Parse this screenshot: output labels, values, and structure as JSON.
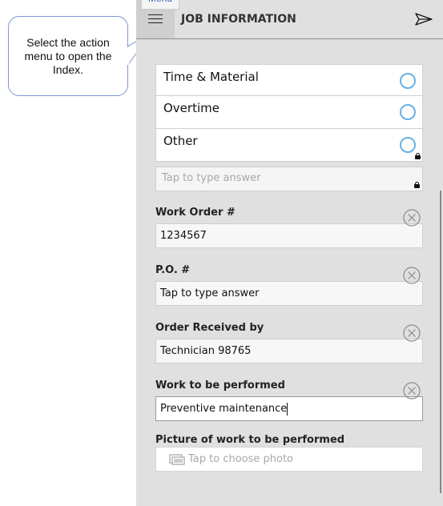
{
  "callout": {
    "text": "Select the action menu to open the Index."
  },
  "header": {
    "tooltip": "Menu",
    "title": "JOB INFORMATION",
    "menu_icon": "hamburger-icon",
    "send_icon": "send-icon"
  },
  "options": [
    {
      "label": "Time & Material",
      "selected": false,
      "locked": false
    },
    {
      "label": "Overtime",
      "selected": false,
      "locked": false
    },
    {
      "label": "Other",
      "selected": false,
      "locked": true
    }
  ],
  "other_input": {
    "placeholder": "Tap to type answer",
    "value": "",
    "locked": true
  },
  "fields": [
    {
      "label": "Work Order #",
      "value": "1234567",
      "placeholder": ""
    },
    {
      "label": "P.O. #",
      "value": "",
      "placeholder": "Tap to type answer"
    },
    {
      "label": "Order Received by",
      "value": "Technician 98765",
      "placeholder": ""
    },
    {
      "label": "Work to be performed",
      "value": "Preventive maintenance",
      "placeholder": ""
    }
  ],
  "photo_field": {
    "label": "Picture of work to be performed",
    "placeholder": "Tap to choose photo",
    "icon": "photo-icon"
  },
  "colors": {
    "radio": "#6ab0e0",
    "callout_border": "#7f95d6",
    "tooltip_text": "#3a5db8"
  }
}
